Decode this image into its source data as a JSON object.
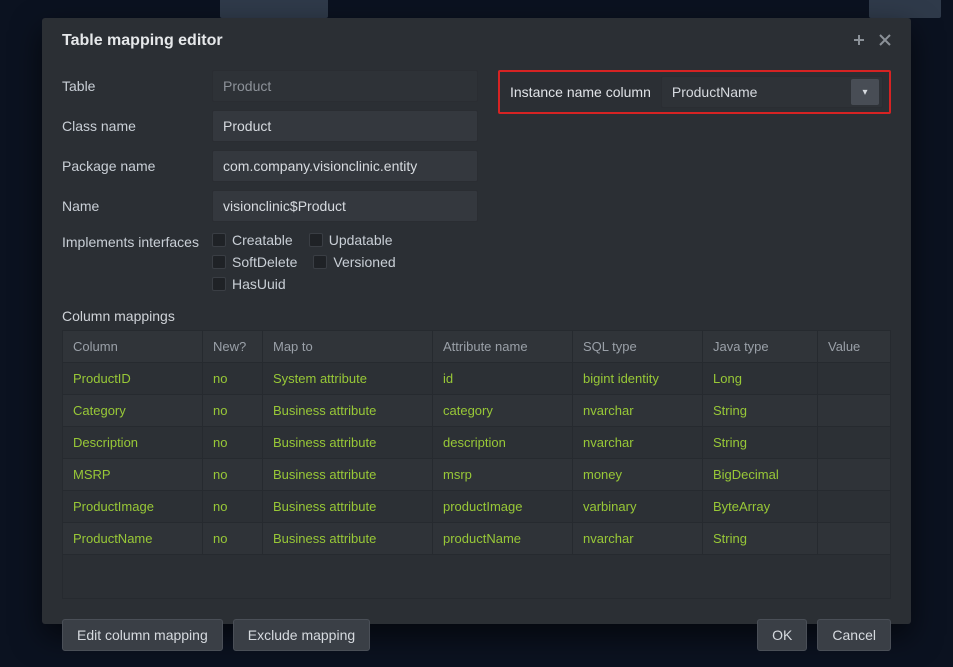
{
  "modal": {
    "title": "Table mapping editor"
  },
  "form": {
    "table_label": "Table",
    "table_value": "Product",
    "class_label": "Class name",
    "class_value": "Product",
    "package_label": "Package name",
    "package_value": "com.company.visionclinic.entity",
    "name_label": "Name",
    "name_value": "visionclinic$Product",
    "interfaces_label": "Implements interfaces",
    "interfaces": {
      "creatable": "Creatable",
      "updatable": "Updatable",
      "softdelete": "SoftDelete",
      "versioned": "Versioned",
      "hasuuid": "HasUuid"
    }
  },
  "instance": {
    "label": "Instance name column",
    "value": "ProductName"
  },
  "mappings": {
    "section_title": "Column mappings",
    "headers": {
      "column": "Column",
      "new_": "New?",
      "map_to": "Map to",
      "attr": "Attribute name",
      "sql": "SQL type",
      "java": "Java type",
      "value": "Value"
    },
    "rows": [
      {
        "column": "ProductID",
        "new": "no",
        "map_to": "System attribute",
        "attr": "id",
        "sql": "bigint identity",
        "java": "Long",
        "value": ""
      },
      {
        "column": "Category",
        "new": "no",
        "map_to": "Business attribute",
        "attr": "category",
        "sql": "nvarchar",
        "java": "String",
        "value": ""
      },
      {
        "column": "Description",
        "new": "no",
        "map_to": "Business attribute",
        "attr": "description",
        "sql": "nvarchar",
        "java": "String",
        "value": ""
      },
      {
        "column": "MSRP",
        "new": "no",
        "map_to": "Business attribute",
        "attr": "msrp",
        "sql": "money",
        "java": "BigDecimal",
        "value": ""
      },
      {
        "column": "ProductImage",
        "new": "no",
        "map_to": "Business attribute",
        "attr": "productImage",
        "sql": "varbinary",
        "java": "ByteArray",
        "value": ""
      },
      {
        "column": "ProductName",
        "new": "no",
        "map_to": "Business attribute",
        "attr": "productName",
        "sql": "nvarchar",
        "java": "String",
        "value": ""
      }
    ]
  },
  "buttons": {
    "edit": "Edit column mapping",
    "exclude": "Exclude mapping",
    "ok": "OK",
    "cancel": "Cancel"
  }
}
